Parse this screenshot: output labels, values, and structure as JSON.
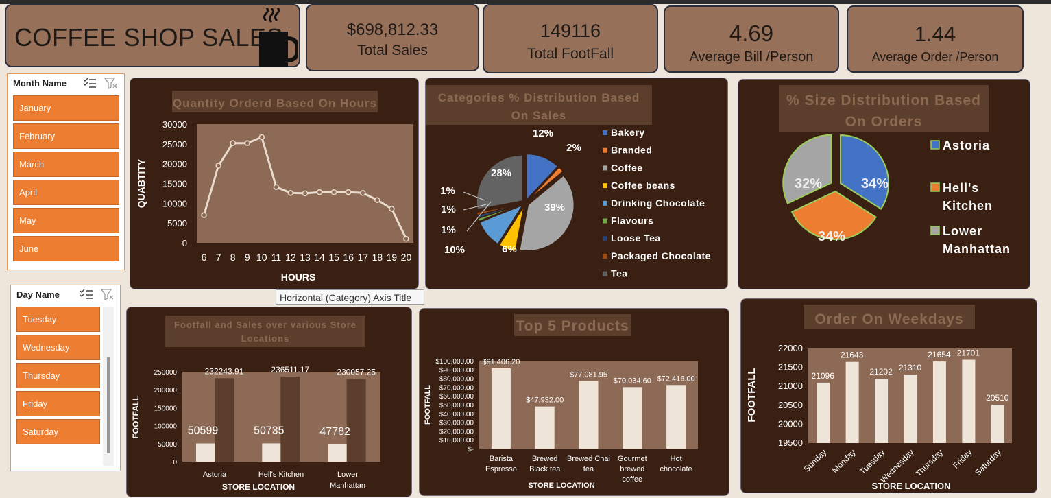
{
  "title": "COFFEE SHOP SALES",
  "kpis": [
    {
      "value": "$698,812.33",
      "label": "Total Sales"
    },
    {
      "value": "149116",
      "label": "Total FootFall"
    },
    {
      "value": "4.69",
      "label": "Average Bill /Person"
    },
    {
      "value": "1.44",
      "label": "Average Order /Person"
    }
  ],
  "month_slicer": {
    "title": "Month Name",
    "items": [
      "January",
      "February",
      "March",
      "April",
      "May",
      "June"
    ]
  },
  "day_slicer": {
    "title": "Day Name",
    "items": [
      "Tuesday",
      "Wednesday",
      "Thursday",
      "Friday",
      "Saturday"
    ]
  },
  "tooltip": "Horizontal (Category) Axis Title",
  "colors": {
    "panel": "#3a2012",
    "plot": "#8d6a55",
    "kpi": "#97705a",
    "slicer": "#ed7d31",
    "bar_light": "#efe4d8",
    "bar_dark": "#5c3e2c"
  },
  "chart_data": [
    {
      "id": "hours",
      "type": "line",
      "title": "Quantity Orderd Based On Hours",
      "xlabel": "HOURS",
      "ylabel": "QUABTITY",
      "x": [
        6,
        7,
        8,
        9,
        10,
        11,
        12,
        13,
        14,
        15,
        16,
        17,
        18,
        19,
        20
      ],
      "values": [
        7000,
        19500,
        25200,
        25200,
        26700,
        14100,
        12600,
        12500,
        12800,
        12800,
        12800,
        12600,
        10800,
        8600,
        1000
      ],
      "ylim": [
        0,
        30000
      ],
      "yticks": [
        "0",
        "5000",
        "10000",
        "15000",
        "20000",
        "25000",
        "30000"
      ]
    },
    {
      "id": "categories",
      "type": "pie",
      "title": "Categories % Distribution Based On Sales",
      "labels": [
        "Bakery",
        "Branded",
        "Coffee",
        "Coffee beans",
        "Drinking Chocolate",
        "Flavours",
        "Loose Tea",
        "Packaged Chocolate",
        "Tea"
      ],
      "values": [
        12,
        2,
        39,
        6,
        10,
        1,
        1,
        1,
        28
      ],
      "value_labels": [
        "12%",
        "2%",
        "39%",
        "6%",
        "10%",
        "1%",
        "1%",
        "1%",
        "28%"
      ],
      "colors": [
        "#4472c4",
        "#ed7d31",
        "#a5a5a5",
        "#ffc000",
        "#5b9bd5",
        "#70ad47",
        "#264478",
        "#9e480e",
        "#636363"
      ],
      "legend": "right"
    },
    {
      "id": "size",
      "type": "pie",
      "title": "% Size Distribution Based On Orders",
      "labels": [
        "Astoria",
        "Hell's Kitchen",
        "Lower Manhattan"
      ],
      "values": [
        34,
        34,
        32
      ],
      "value_labels": [
        "34%",
        "34%",
        "32%"
      ],
      "colors": [
        "#4472c4",
        "#ed7d31",
        "#a5a5a5"
      ],
      "legend": "right"
    },
    {
      "id": "stores",
      "type": "bar",
      "title": "Footfall and Sales over various Store Locations",
      "xlabel": "STORE  LOCATION",
      "ylabel": "FOOTFALL",
      "categories": [
        "Astoria",
        "Hell's Kitchen",
        "Lower Manhattan"
      ],
      "series": [
        {
          "values": [
            50599,
            50735,
            47782
          ],
          "labels": [
            "50599",
            "50735",
            "47782"
          ]
        },
        {
          "values": [
            232243.91,
            236511.17,
            230057.25
          ],
          "labels": [
            "232243.91",
            "236511.17",
            "230057.25"
          ]
        }
      ],
      "ylim": [
        0,
        250000
      ],
      "yticks": [
        "0",
        "50000",
        "100000",
        "150000",
        "200000",
        "250000"
      ]
    },
    {
      "id": "products",
      "type": "bar",
      "title": "Top 5 Products",
      "xlabel": "STORE  LOCATION",
      "ylabel": "FOOTFALL",
      "categories": [
        "Barista Espresso",
        "Brewed Black tea",
        "Brewed Chai tea",
        "Gourmet brewed coffee",
        "Hot chocolate"
      ],
      "values": [
        91406.2,
        47932.0,
        77081.95,
        70034.6,
        72416.0
      ],
      "value_labels": [
        "$91,406.20",
        "$47,932.00",
        "$77,081.95",
        "$70,034.60",
        "$72,416.00"
      ],
      "ylim": [
        0,
        100000
      ],
      "yticks": [
        "$-",
        "$10,000.00",
        "$20,000.00",
        "$30,000.00",
        "$40,000.00",
        "$50,000.00",
        "$60,000.00",
        "$70,000.00",
        "$80,000.00",
        "$90,000.00",
        "$100,000.00"
      ]
    },
    {
      "id": "weekdays",
      "type": "bar",
      "title": "Order On Weekdays",
      "xlabel": "STORE  LOCATION",
      "ylabel": "FOOTFALL",
      "categories": [
        "Sunday",
        "Monday",
        "Tuesday",
        "Wednesday",
        "Thursday",
        "Friday",
        "Saturday"
      ],
      "values": [
        21096,
        21643,
        21202,
        21310,
        21654,
        21701,
        20510
      ],
      "value_labels": [
        "21096",
        "21643",
        "21202",
        "21310",
        "21654",
        "21701",
        "20510"
      ],
      "ylim": [
        19500,
        22000
      ],
      "yticks": [
        "19500",
        "20000",
        "20500",
        "21000",
        "21500",
        "22000"
      ]
    }
  ]
}
